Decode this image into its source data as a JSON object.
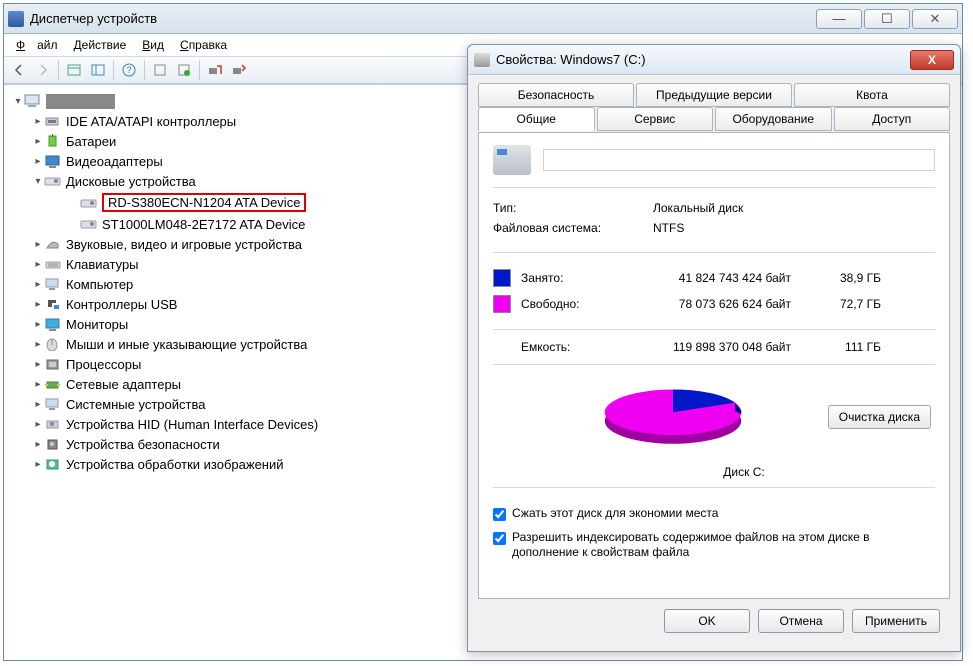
{
  "device_manager": {
    "title": "Диспетчер устройств",
    "menu": {
      "file": "Файл",
      "action": "Действие",
      "view": "Вид",
      "help": "Справка"
    },
    "tree": {
      "root": "",
      "categories": [
        {
          "label": "IDE ATA/ATAPI контроллеры"
        },
        {
          "label": "Батареи"
        },
        {
          "label": "Видеоадаптеры"
        },
        {
          "label": "Дисковые устройства",
          "expanded": true,
          "children": [
            {
              "label": "RD-S380ECN-N1204 ATA Device",
              "highlighted": true
            },
            {
              "label": "ST1000LM048-2E7172 ATA Device"
            }
          ]
        },
        {
          "label": "Звуковые, видео и игровые устройства"
        },
        {
          "label": "Клавиатуры"
        },
        {
          "label": "Компьютер"
        },
        {
          "label": "Контроллеры USB"
        },
        {
          "label": "Мониторы"
        },
        {
          "label": "Мыши и иные указывающие устройства"
        },
        {
          "label": "Процессоры"
        },
        {
          "label": "Сетевые адаптеры"
        },
        {
          "label": "Системные устройства"
        },
        {
          "label": "Устройства HID (Human Interface Devices)"
        },
        {
          "label": "Устройства безопасности"
        },
        {
          "label": "Устройства обработки изображений"
        }
      ]
    }
  },
  "properties": {
    "title": "Свойства: Windows7 (C:)",
    "tabs_row1": [
      "Безопасность",
      "Предыдущие версии",
      "Квота"
    ],
    "tabs_row2": [
      "Общие",
      "Сервис",
      "Оборудование",
      "Доступ"
    ],
    "active_tab": "Общие",
    "drive_name": "",
    "type_label": "Тип:",
    "type_value": "Локальный диск",
    "fs_label": "Файловая система:",
    "fs_value": "NTFS",
    "used_label": "Занято:",
    "used_bytes": "41 824 743 424 байт",
    "used_gb": "38,9 ГБ",
    "free_label": "Свободно:",
    "free_bytes": "78 073 626 624 байт",
    "free_gb": "72,7 ГБ",
    "capacity_label": "Емкость:",
    "capacity_bytes": "119 898 370 048 байт",
    "capacity_gb": "111 ГБ",
    "disk_label": "Диск C:",
    "cleanup_button": "Очистка диска",
    "compress_label": "Сжать этот диск для экономии места",
    "index_label": "Разрешить индексировать содержимое файлов на этом диске в дополнение к свойствам файла",
    "ok": "OK",
    "cancel": "Отмена",
    "apply": "Применить"
  },
  "chart_data": {
    "type": "pie",
    "title": "Диск C:",
    "series": [
      {
        "name": "Занято",
        "value": 41824743424,
        "display": "38,9 ГБ",
        "color": "#0018c8"
      },
      {
        "name": "Свободно",
        "value": 78073626624,
        "display": "72,7 ГБ",
        "color": "#f000f0"
      }
    ],
    "total": {
      "name": "Емкость",
      "value": 119898370048,
      "display": "111 ГБ"
    }
  }
}
